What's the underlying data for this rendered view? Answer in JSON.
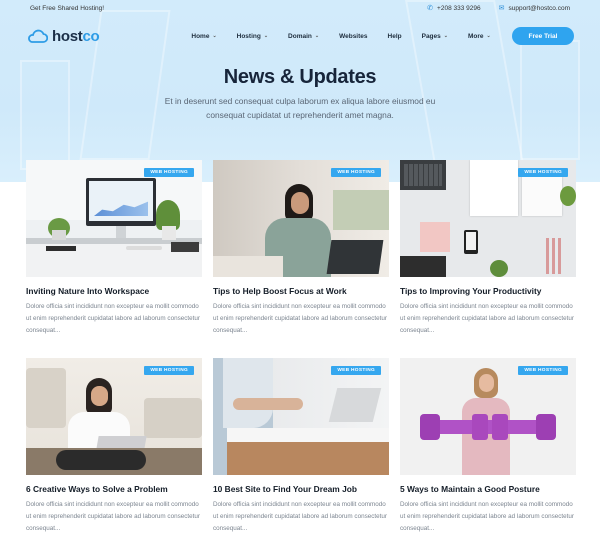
{
  "topbar": {
    "promo": "Get Free Shared Hosting!",
    "phone": "+208 333 9296",
    "email": "support@hostco.com",
    "phone_icon": "phone-icon",
    "email_icon": "envelope-icon"
  },
  "brand": {
    "logo_part1": "host",
    "logo_part2": "co",
    "logo_icon": "cloud-icon"
  },
  "nav": {
    "items": [
      {
        "label": "Home",
        "caret": true
      },
      {
        "label": "Hosting",
        "caret": true
      },
      {
        "label": "Domain",
        "caret": true
      },
      {
        "label": "Websites",
        "caret": false
      },
      {
        "label": "Help",
        "caret": false
      },
      {
        "label": "Pages",
        "caret": true
      },
      {
        "label": "More",
        "caret": true
      }
    ],
    "cta": "Free Trial"
  },
  "hero": {
    "title": "News & Updates",
    "subtitle": "Et in deserunt sed consequat culpa laborum ex aliqua labore eiusmod eu consequat cupidatat ut reprehenderit amet magna."
  },
  "posts": [
    {
      "badge": "WEB HOSTING",
      "title": "Inviting Nature Into Workspace",
      "excerpt": "Dolore officia sint incididunt non excepteur ea mollit commodo ut enim reprehenderit cupidatat labore ad laborum consectetur consequat..."
    },
    {
      "badge": "WEB HOSTING",
      "title": "Tips to Help Boost Focus at Work",
      "excerpt": "Dolore officia sint incididunt non excepteur ea mollit commodo ut enim reprehenderit cupidatat labore ad laborum consectetur consequat..."
    },
    {
      "badge": "WEB HOSTING",
      "title": "Tips to Improving Your Productivity",
      "excerpt": "Dolore officia sint incididunt non excepteur ea mollit commodo ut enim reprehenderit cupidatat labore ad laborum consectetur consequat..."
    },
    {
      "badge": "WEB HOSTING",
      "title": "6 Creative Ways to Solve a Problem",
      "excerpt": "Dolore officia sint incididunt non excepteur ea mollit commodo ut enim reprehenderit cupidatat labore ad laborum consectetur consequat..."
    },
    {
      "badge": "WEB HOSTING",
      "title": "10 Best Site to Find Your Dream Job",
      "excerpt": "Dolore officia sint incididunt non excepteur ea mollit commodo ut enim reprehenderit cupidatat labore ad laborum consectetur consequat..."
    },
    {
      "badge": "WEB HOSTING",
      "title": "5 Ways to Maintain a Good Posture",
      "excerpt": "Dolore officia sint incididunt non excepteur ea mollit commodo ut enim reprehenderit cupidatat labore ad laborum consectetur consequat..."
    }
  ],
  "colors": {
    "accent": "#2fa4ef",
    "hero_bg": "#d2ebfb",
    "title": "#17253a"
  }
}
